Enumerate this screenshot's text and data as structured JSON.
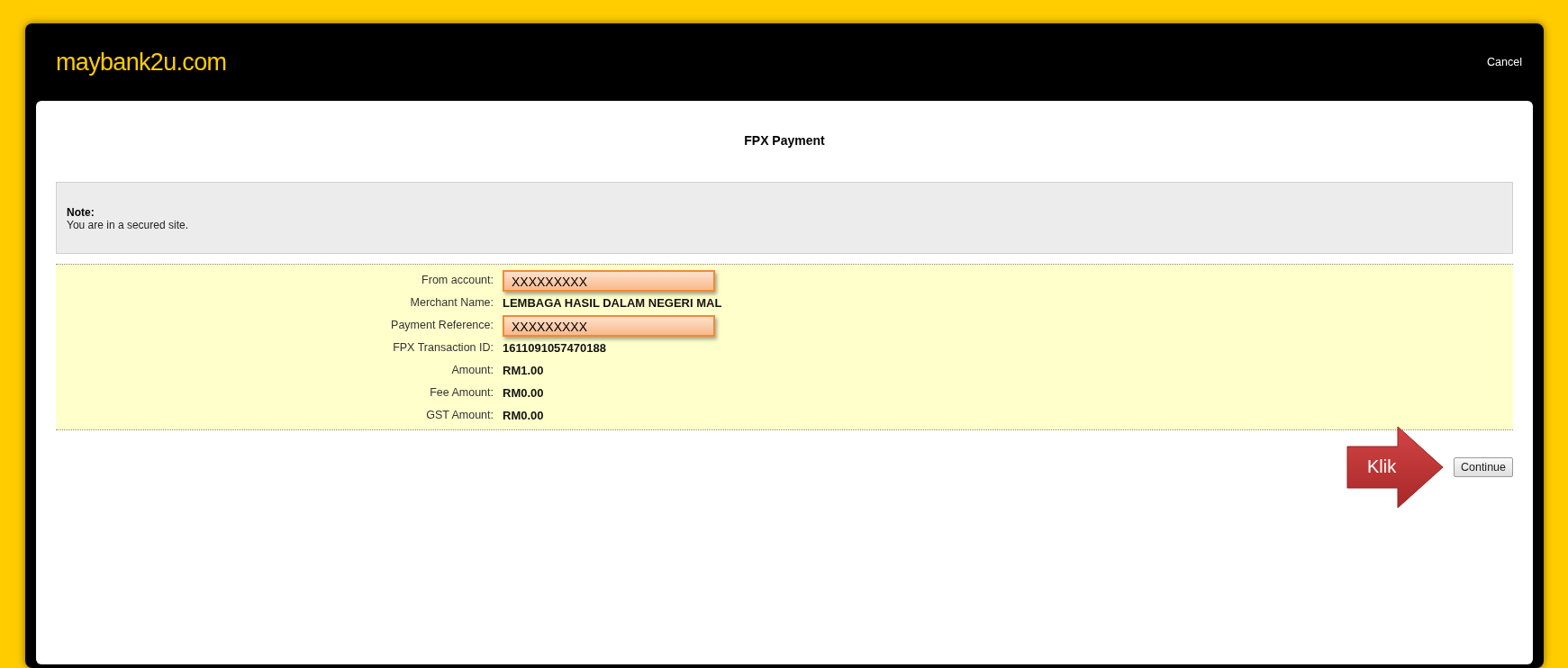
{
  "header": {
    "logo": "maybank2u.com",
    "cancel": "Cancel"
  },
  "title": "FPX Payment",
  "note": {
    "heading": "Note:",
    "text": "You are in a secured site."
  },
  "details": [
    {
      "label": "From account:",
      "value": "XXXXXXXXX",
      "highlighted": true
    },
    {
      "label": "Merchant Name:",
      "value": "LEMBAGA HASIL DALAM NEGERI MAL",
      "highlighted": false
    },
    {
      "label": "Payment Reference:",
      "value": "XXXXXXXXX",
      "highlighted": true
    },
    {
      "label": "FPX Transaction ID:",
      "value": "1611091057470188",
      "highlighted": false
    },
    {
      "label": "Amount:",
      "value": "RM1.00",
      "highlighted": false
    },
    {
      "label": "Fee Amount:",
      "value": "RM0.00",
      "highlighted": false
    },
    {
      "label": "GST Amount:",
      "value": "RM0.00",
      "highlighted": false
    }
  ],
  "callout": "Klik",
  "button": "Continue"
}
